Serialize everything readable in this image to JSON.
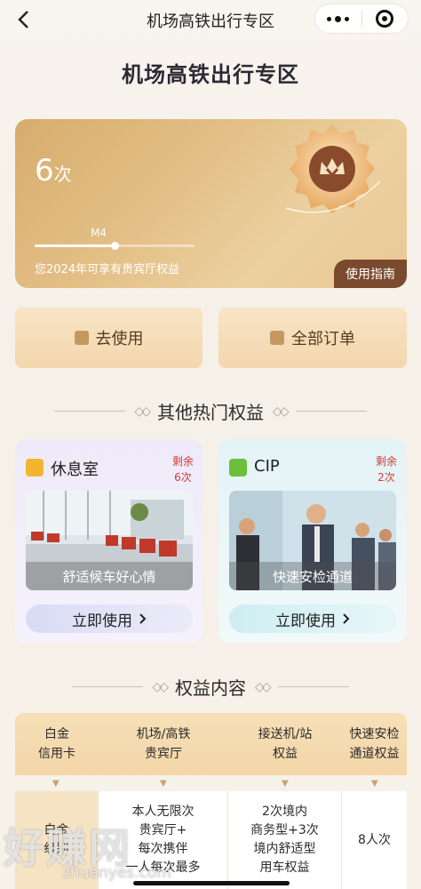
{
  "nav": {
    "title": "机场高铁出行专区"
  },
  "page_title": "机场高铁出行专区",
  "card": {
    "count_value": "6",
    "count_unit": "次",
    "level": "M4",
    "level_progress": 0.5,
    "desc": "您2024年可享有贵宾厅权益",
    "guide_label": "使用指南"
  },
  "actions": [
    {
      "label": "去使用"
    },
    {
      "label": "全部订单"
    }
  ],
  "sections": {
    "hot": "其他热门权益",
    "content": "权益内容"
  },
  "benefits": [
    {
      "name": "休息室",
      "remain_label": "剩余",
      "remain_count": "6次",
      "caption": "舒适候车好心情",
      "use_label": "立即使用",
      "icon_color": "#f2b531"
    },
    {
      "name": "CIP",
      "remain_label": "剩余",
      "remain_count": "2次",
      "caption": "快速安检通道",
      "use_label": "立即使用",
      "icon_color": "#6bbf3a"
    }
  ],
  "table": {
    "headers": [
      "白金\n信用卡",
      "机场/高铁\n贵宾厅",
      "接送机/站\n权益",
      "快速安检\n通道权益"
    ],
    "cells": [
      "白金\n级别",
      "本人无限次\n贵宾厅+\n每次携伴\n一人每次最多",
      "2次境内\n商务型+3次\n境内舒适型\n用车权益",
      "8人次"
    ]
  },
  "watermark": {
    "text": "好赚网",
    "url": "zhuanyes.com"
  }
}
